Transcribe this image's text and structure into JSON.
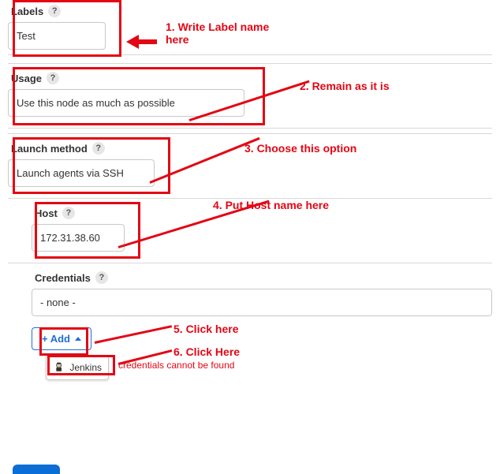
{
  "labels_section": {
    "label": "Labels",
    "value": "Test"
  },
  "usage_section": {
    "label": "Usage",
    "value": "Use this node as much as possible"
  },
  "launch_section": {
    "label": "Launch method",
    "value": "Launch agents via SSH"
  },
  "host_section": {
    "label": "Host",
    "value": "172.31.38.60"
  },
  "credentials_section": {
    "label": "Credentials",
    "value": "- none -",
    "add_label": "+ Add",
    "menu_item": "Jenkins",
    "error": "credentials cannot be found"
  },
  "annotations": {
    "a1": "1. Write Label name here",
    "a2": "2. Remain as it is",
    "a3": "3. Choose this option",
    "a4": "4. Put Host name here",
    "a5": "5. Click here",
    "a6": "6. Click Here"
  },
  "help_glyph": "?"
}
